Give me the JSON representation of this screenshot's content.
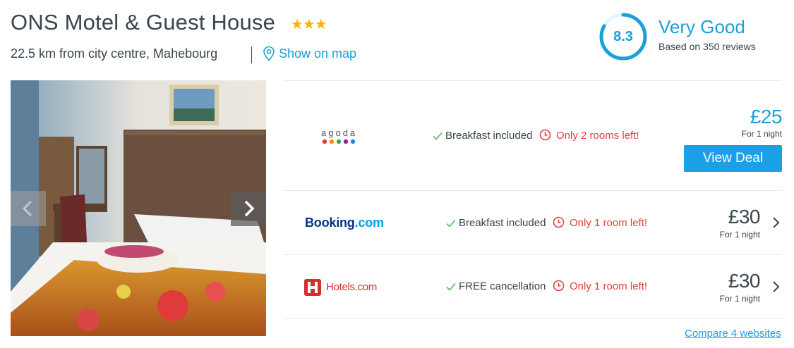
{
  "hotel": {
    "name": "ONS Motel & Guest House",
    "star_rating": 3,
    "stars_glyph": "★★★",
    "location": "22.5 km from city centre, Mahebourg",
    "map_link": "Show on map",
    "map_icon": "location-pin-icon"
  },
  "rating": {
    "score": "8.3",
    "score_fraction": 0.83,
    "label": "Very Good",
    "reviews": "Based on 350 reviews",
    "color": "#1ba0d8"
  },
  "gallery": {
    "prev_icon": "chevron-left-icon",
    "next_icon": "chevron-right-icon"
  },
  "deals": [
    {
      "provider": "agoda",
      "provider_logo_text": "agoda",
      "feature": "Breakfast included",
      "urgency": "Only 2 rooms left!",
      "price": "£25",
      "price_note": "For 1 night",
      "cta": "View Deal"
    },
    {
      "provider": "Booking.com",
      "provider_logo_main": "Booking",
      "provider_logo_suffix": ".com",
      "feature": "Breakfast included",
      "urgency": "Only 1 room left!",
      "price": "£30",
      "price_note": "For 1 night"
    },
    {
      "provider": "Hotels.com",
      "provider_logo_text": "Hotels.com",
      "feature": "FREE cancellation",
      "urgency": "Only 1 room left!",
      "price": "£30",
      "price_note": "For 1 night"
    }
  ],
  "compare_link": "Compare 4 websites",
  "colors": {
    "accent": "#1ba0d8",
    "button": "#1ba0e6",
    "urgent": "#e0403f",
    "check": "#5cb85c",
    "star": "#f7b500",
    "text": "#37454d"
  }
}
